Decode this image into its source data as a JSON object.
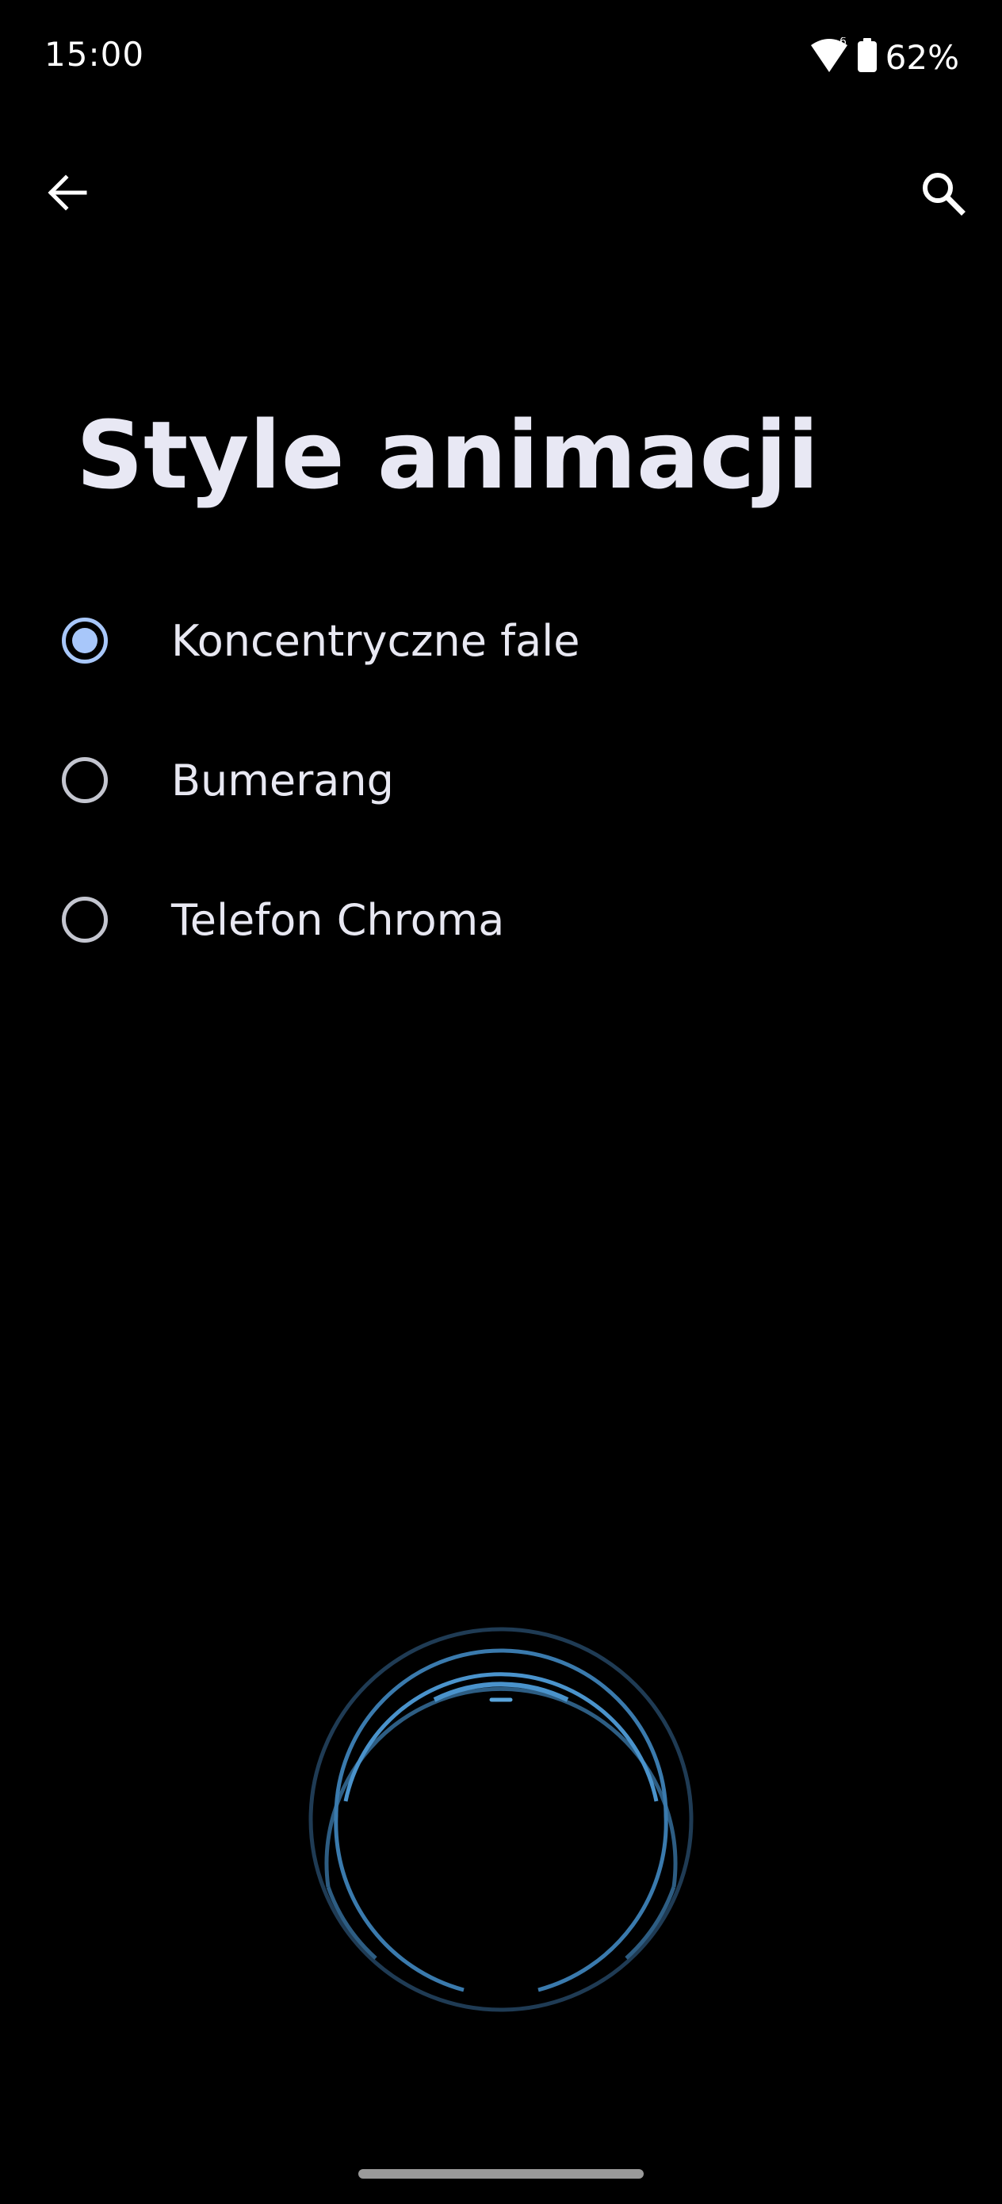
{
  "status_bar": {
    "time": "15:00",
    "wifi_icon": "wifi-icon",
    "wifi_badge": "6",
    "battery_icon": "battery-icon",
    "battery_percent": "62%"
  },
  "top_bar": {
    "back_icon": "arrow-back-icon",
    "search_icon": "search-icon"
  },
  "page": {
    "title": "Style animacji"
  },
  "options": [
    {
      "label": "Koncentryczne fale",
      "selected": true
    },
    {
      "label": "Bumerang",
      "selected": false
    },
    {
      "label": "Telefon Chroma",
      "selected": false
    }
  ],
  "colors": {
    "background": "#000000",
    "accent": "#a8c7fa",
    "preview_ring": "#3f8ec8"
  }
}
